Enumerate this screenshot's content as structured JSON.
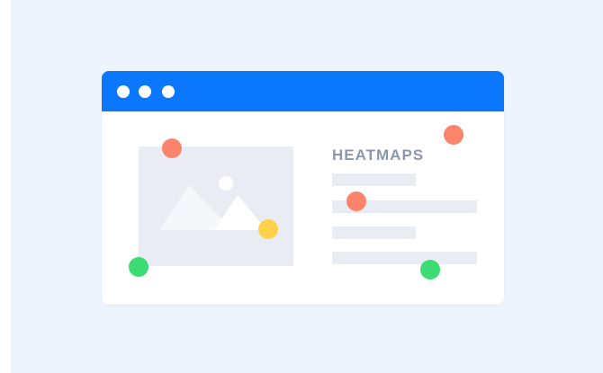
{
  "illustration": {
    "heading": "HEATMAPS",
    "colors": {
      "background": "#eef4fe",
      "titlebar": "#0a77fd",
      "placeholder": "#e9edf3",
      "heading_text": "#8b97ab"
    },
    "window_controls": [
      {
        "name": "window-dot-1-icon"
      },
      {
        "name": "window-dot-2-icon"
      },
      {
        "name": "window-dot-3-icon"
      }
    ],
    "heat_spots": [
      {
        "id": "spot-1",
        "level": "high",
        "color": "#fd846b"
      },
      {
        "id": "spot-2",
        "level": "high",
        "color": "#fd846b"
      },
      {
        "id": "spot-3",
        "level": "high",
        "color": "#fd846b"
      },
      {
        "id": "spot-4",
        "level": "medium",
        "color": "#fdd14a"
      },
      {
        "id": "spot-5",
        "level": "low",
        "color": "#3ddc73"
      },
      {
        "id": "spot-6",
        "level": "low",
        "color": "#3ddc73"
      }
    ]
  }
}
